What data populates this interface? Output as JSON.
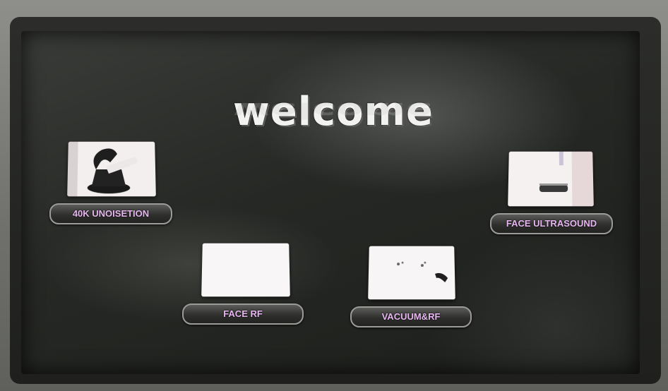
{
  "screen": {
    "title": "welcome"
  },
  "modes": [
    {
      "label": "40K UNOISETION",
      "icon": "handpiece-icon"
    },
    {
      "label": "FACE ULTRASOUND",
      "icon": "ultrasound-icon"
    },
    {
      "label": "FACE RF",
      "icon": "rf-icon"
    },
    {
      "label": "VACUUM&RF",
      "icon": "vacuum-icon"
    }
  ]
}
